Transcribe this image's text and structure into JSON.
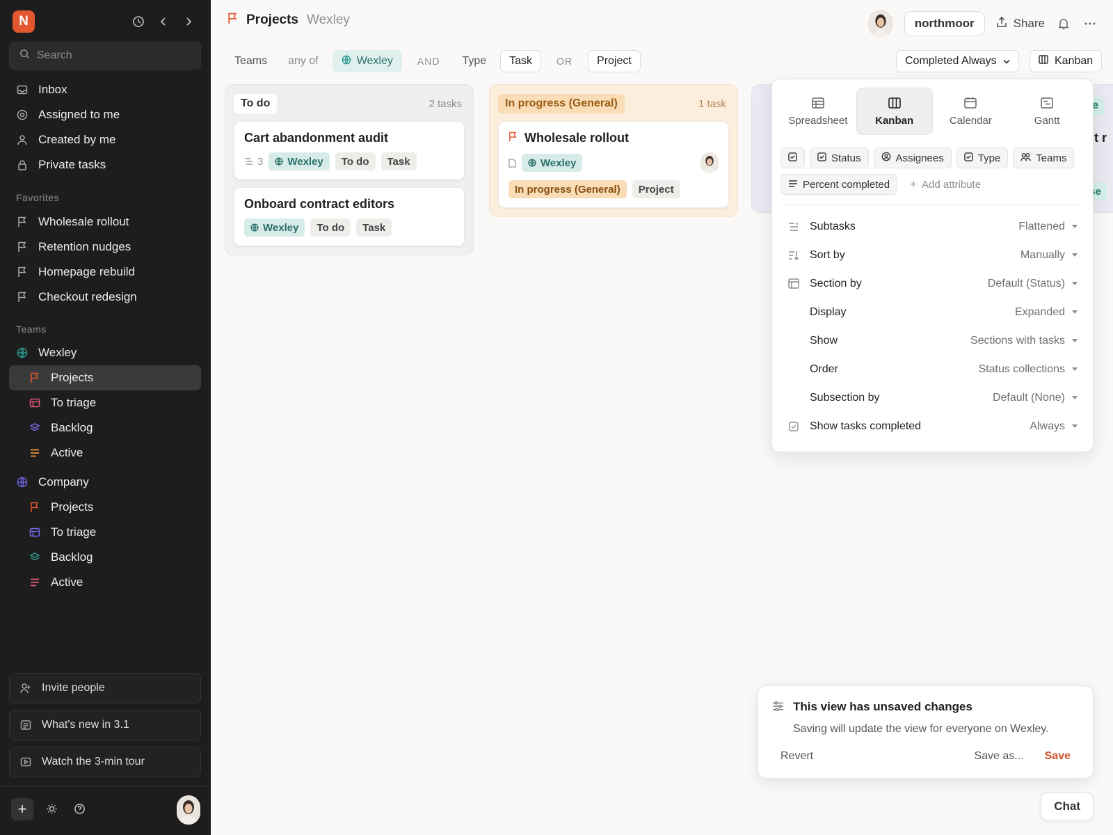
{
  "sidebar": {
    "logo_letter": "N",
    "search_placeholder": "Search",
    "nav": [
      {
        "label": "Inbox",
        "icon": "inbox-icon"
      },
      {
        "label": "Assigned to me",
        "icon": "target-icon"
      },
      {
        "label": "Created by me",
        "icon": "person-icon"
      },
      {
        "label": "Private tasks",
        "icon": "lock-icon"
      }
    ],
    "favorites_title": "Favorites",
    "favorites": [
      {
        "label": "Wholesale rollout"
      },
      {
        "label": "Retention nudges"
      },
      {
        "label": "Homepage rebuild"
      },
      {
        "label": "Checkout redesign"
      }
    ],
    "teams_title": "Teams",
    "teams": [
      {
        "name": "Wexley",
        "color": "#2f9a8f",
        "items": [
          "Projects",
          "To triage",
          "Backlog",
          "Active"
        ]
      },
      {
        "name": "Company",
        "color": "#6b63d9",
        "items": [
          "Projects",
          "To triage",
          "Backlog",
          "Active"
        ]
      }
    ],
    "bottom": [
      {
        "label": "Invite people",
        "icon": "invite-person-icon"
      },
      {
        "label": "What's new in 3.1",
        "icon": "news-icon"
      },
      {
        "label": "Watch the 3-min tour",
        "icon": "video-icon"
      }
    ]
  },
  "header": {
    "title": "Projects",
    "subtitle": "Wexley",
    "user": "northmoor",
    "share": "Share"
  },
  "filters": {
    "teams": "Teams",
    "any_of": "any of",
    "team_chip": "Wexley",
    "and": "AND",
    "type": "Type",
    "task": "Task",
    "or": "OR",
    "project": "Project",
    "completed": "Completed Always",
    "view": "Kanban"
  },
  "board": {
    "todo": {
      "label": "To do",
      "count": "2 tasks",
      "cards": [
        {
          "title": "Cart abandonment audit",
          "subtasks": "3",
          "team": "Wexley",
          "status": "To do",
          "type": "Task"
        },
        {
          "title": "Onboard contract editors",
          "team": "Wexley",
          "status": "To do",
          "type": "Task"
        }
      ]
    },
    "progress": {
      "label": "In progress (General)",
      "count": "1 task",
      "cards": [
        {
          "title": "Wholesale rollout",
          "team": "Wexley",
          "status": "In progress (General)",
          "type": "Project"
        }
      ]
    },
    "peek": {
      "label_fragment": "ase",
      "title_fragment": "ut r",
      "tag_fragment": "ase"
    }
  },
  "view_menu": {
    "tabs": [
      {
        "label": "Spreadsheet",
        "icon": "spreadsheet-icon"
      },
      {
        "label": "Kanban",
        "icon": "kanban-icon"
      },
      {
        "label": "Calendar",
        "icon": "calendar-icon"
      },
      {
        "label": "Gantt",
        "icon": "gantt-icon"
      }
    ],
    "attributes": [
      "Status",
      "Assignees",
      "Type",
      "Teams",
      "Percent completed"
    ],
    "add_attribute": "Add attribute",
    "options": [
      {
        "label": "Subtasks",
        "value": "Flattened",
        "icon": "subtasks-icon"
      },
      {
        "label": "Sort by",
        "value": "Manually",
        "icon": "sort-icon"
      },
      {
        "label": "Section by",
        "value": "Default (Status)",
        "icon": "section-icon"
      },
      {
        "label": "Display",
        "value": "Expanded",
        "icon": ""
      },
      {
        "label": "Show",
        "value": "Sections with tasks",
        "icon": ""
      },
      {
        "label": "Order",
        "value": "Status collections",
        "icon": ""
      },
      {
        "label": "Subsection by",
        "value": "Default (None)",
        "icon": ""
      },
      {
        "label": "Show tasks completed",
        "value": "Always",
        "icon": "checkbox-icon"
      }
    ]
  },
  "toast": {
    "title": "This view has unsaved changes",
    "text": "Saving will update the view for everyone on Wexley.",
    "revert": "Revert",
    "save_as": "Save as...",
    "save": "Save"
  },
  "chat": "Chat"
}
